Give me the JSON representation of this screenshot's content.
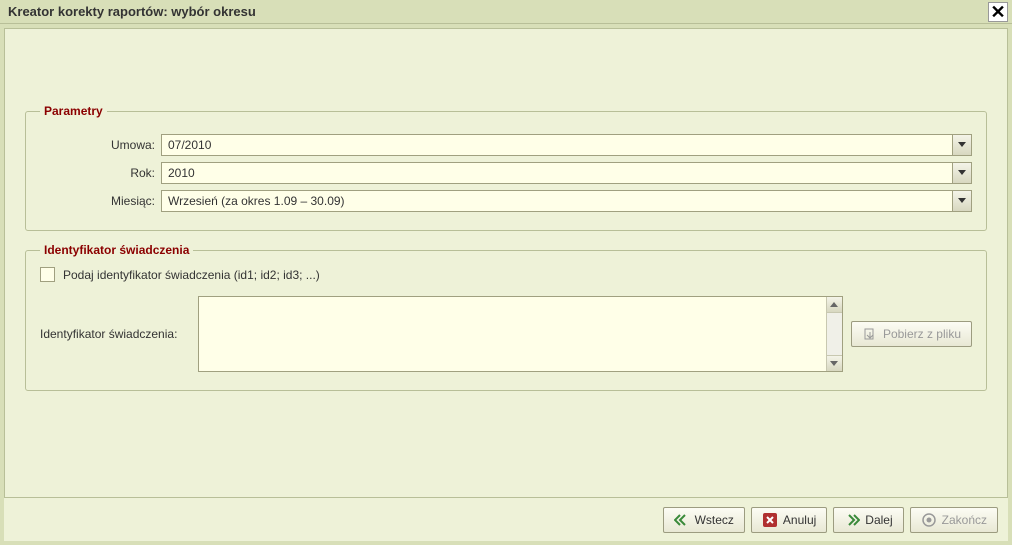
{
  "title": "Kreator korekty raportów: wybór okresu",
  "fieldset1": {
    "legend": "Parametry",
    "umowa_label": "Umowa:",
    "umowa_value": "07/2010",
    "rok_label": "Rok:",
    "rok_value": "2010",
    "miesiac_label": "Miesiąc:",
    "miesiac_value": "Wrzesień (za okres 1.09 – 30.09)"
  },
  "fieldset2": {
    "legend": "Identyfikator świadczenia",
    "checkbox_label": "Podaj identyfikator świadczenia (id1; id2; id3; ...)",
    "ident_label": "Identyfikator świadczenia:",
    "ident_value": "",
    "load_button": "Pobierz z pliku"
  },
  "footer": {
    "back": "Wstecz",
    "cancel": "Anuluj",
    "next": "Dalej",
    "finish": "Zakończ"
  }
}
